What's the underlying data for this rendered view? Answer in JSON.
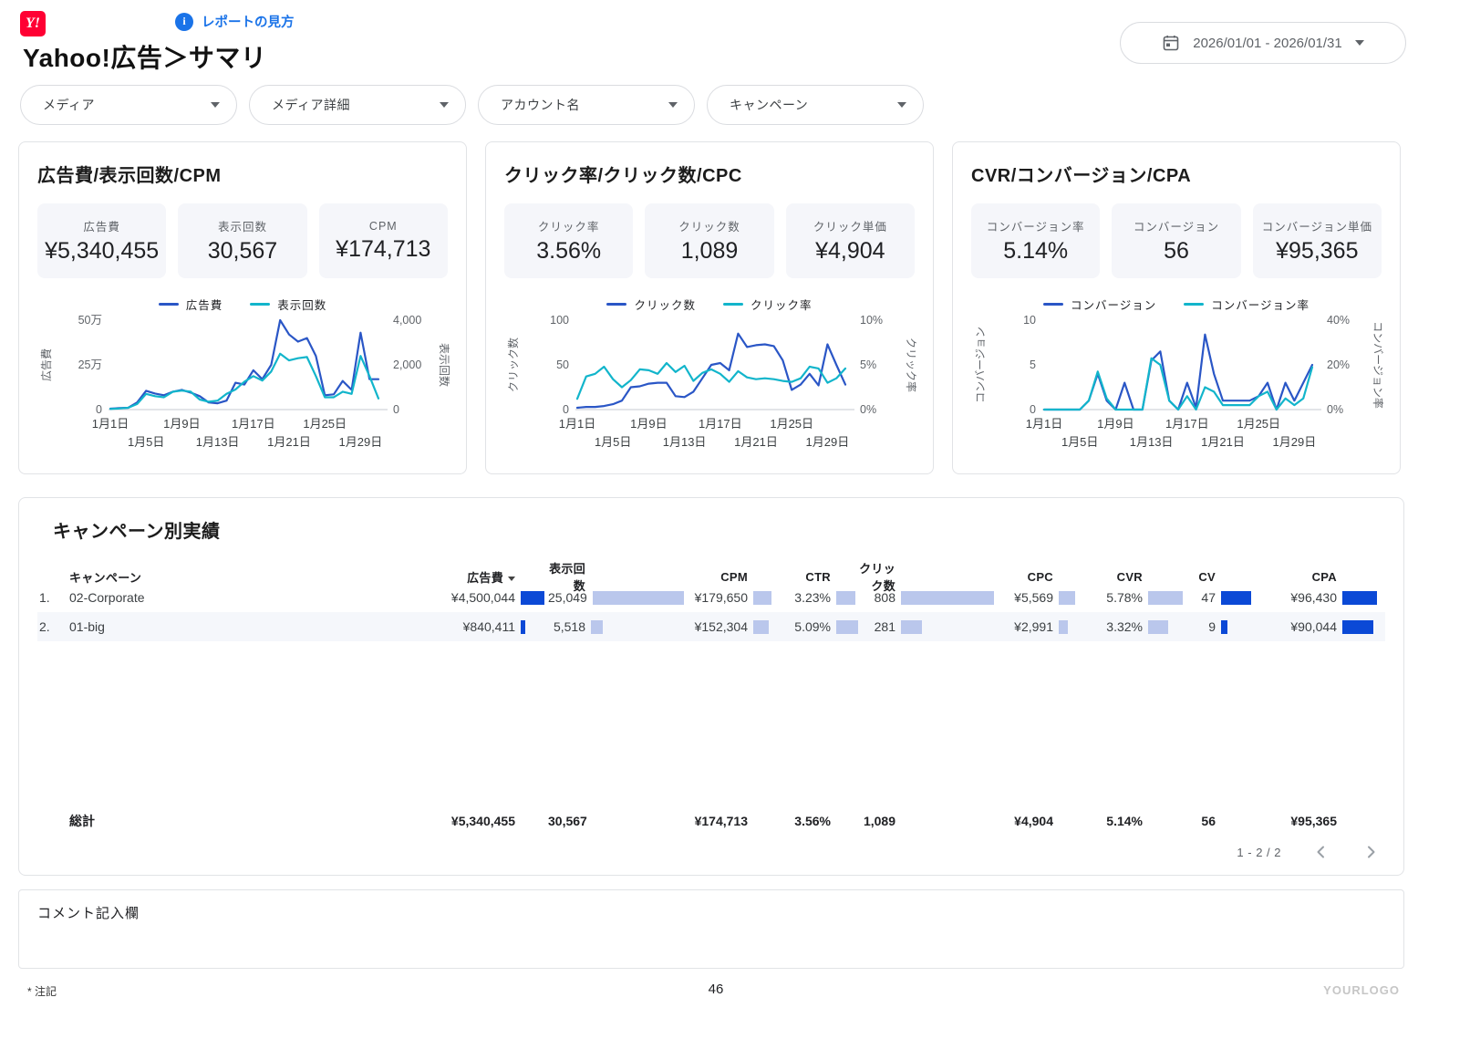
{
  "header": {
    "logo_text": "Y!",
    "help_label": "レポートの見方",
    "title": "Yahoo!広告＞サマリ",
    "date_range": "2026/01/01 - 2026/01/31"
  },
  "filters": [
    {
      "label": "メディア"
    },
    {
      "label": "メディア詳細"
    },
    {
      "label": "アカウント名"
    },
    {
      "label": "キャンペーン"
    }
  ],
  "colors": {
    "series_blue": "#2a56c6",
    "series_teal": "#12b5cb",
    "bar_dark": "#0b49d6",
    "bar_light": "#bac7ec",
    "link_blue": "#1a73e8",
    "logo_red": "#ff0033"
  },
  "cards": [
    {
      "title": "広告費/表示回数/CPM",
      "scorecards": [
        {
          "label": "広告費",
          "value": "¥5,340,455"
        },
        {
          "label": "表示回数",
          "value": "30,567"
        },
        {
          "label": "CPM",
          "value": "¥174,713"
        }
      ]
    },
    {
      "title": "クリック率/クリック数/CPC",
      "scorecards": [
        {
          "label": "クリック率",
          "value": "3.56%"
        },
        {
          "label": "クリック数",
          "value": "1,089"
        },
        {
          "label": "クリック単価",
          "value": "¥4,904"
        }
      ]
    },
    {
      "title": "CVR/コンバージョン/CPA",
      "scorecards": [
        {
          "label": "コンバージョン率",
          "value": "5.14%"
        },
        {
          "label": "コンバージョン",
          "value": "56"
        },
        {
          "label": "コンバージョン単価",
          "value": "¥95,365"
        }
      ]
    }
  ],
  "chart_data": [
    {
      "type": "line",
      "x_tick_days": [
        1,
        5,
        9,
        13,
        17,
        21,
        25,
        29
      ],
      "x_tick_labels": [
        "1月1日",
        "1月5日",
        "1月9日",
        "1月13日",
        "1月17日",
        "1月21日",
        "1月25日",
        "1月29日"
      ],
      "left_axis": {
        "label": "広告費",
        "ticks": [
          "0",
          "25万",
          "50万"
        ],
        "max": 50,
        "unit": "万円"
      },
      "right_axis": {
        "label": "表示回数",
        "ticks": [
          "0",
          "2,000",
          "4,000"
        ],
        "max": 4000
      },
      "series": [
        {
          "name": "広告費",
          "axis": "left",
          "color_key": "series_blue",
          "values": [
            0.5,
            0.8,
            1,
            4,
            10.5,
            9,
            8,
            10,
            11,
            9.5,
            7.5,
            4,
            3.5,
            5,
            15,
            14,
            22,
            17,
            25,
            50,
            42,
            38,
            40,
            30,
            8,
            8.5,
            16,
            11,
            43,
            17,
            17
          ]
        },
        {
          "name": "表示回数",
          "axis": "right",
          "color_key": "series_teal",
          "values": [
            30,
            50,
            80,
            250,
            700,
            600,
            550,
            800,
            850,
            800,
            450,
            350,
            400,
            700,
            900,
            1250,
            1500,
            1300,
            1700,
            2500,
            2200,
            2300,
            2350,
            1500,
            550,
            550,
            800,
            700,
            2400,
            1500,
            500
          ]
        }
      ]
    },
    {
      "type": "line",
      "x_tick_days": [
        1,
        5,
        9,
        13,
        17,
        21,
        25,
        29
      ],
      "x_tick_labels": [
        "1月1日",
        "1月5日",
        "1月9日",
        "1月13日",
        "1月17日",
        "1月21日",
        "1月25日",
        "1月29日"
      ],
      "left_axis": {
        "label": "クリック数",
        "ticks": [
          "0",
          "50",
          "100"
        ],
        "max": 100
      },
      "right_axis": {
        "label": "クリック率",
        "ticks": [
          "0%",
          "5%",
          "10%"
        ],
        "max": 10,
        "unit": "%"
      },
      "series": [
        {
          "name": "クリック数",
          "axis": "left",
          "color_key": "series_blue",
          "values": [
            2,
            3,
            3,
            4,
            6,
            10,
            25,
            26,
            29,
            30,
            30,
            15,
            14,
            20,
            35,
            50,
            52,
            44,
            85,
            70,
            72,
            73,
            71,
            55,
            22,
            28,
            40,
            27,
            73,
            50,
            28
          ]
        },
        {
          "name": "クリック率",
          "axis": "right",
          "color_key": "series_teal",
          "values": [
            1.2,
            3.7,
            4,
            4.8,
            3.4,
            2.5,
            3.3,
            4.5,
            4.4,
            4,
            5.2,
            4.2,
            4.9,
            3.2,
            4.1,
            4.5,
            4,
            3.1,
            4.3,
            3.6,
            3.4,
            3.5,
            3.4,
            3.2,
            3.1,
            3.5,
            4.8,
            4.6,
            3,
            3.5,
            4.6
          ]
        }
      ]
    },
    {
      "type": "line",
      "x_tick_days": [
        1,
        5,
        9,
        13,
        17,
        21,
        25,
        29
      ],
      "x_tick_labels": [
        "1月1日",
        "1月5日",
        "1月9日",
        "1月13日",
        "1月17日",
        "1月21日",
        "1月25日",
        "1月29日"
      ],
      "left_axis": {
        "label": "コンバージョン",
        "ticks": [
          "0",
          "5",
          "10"
        ],
        "max": 10
      },
      "right_axis": {
        "label": "コンバージョン率",
        "ticks": [
          "0%",
          "20%",
          "40%"
        ],
        "max": 40,
        "unit": "%"
      },
      "series": [
        {
          "name": "コンバージョン",
          "axis": "left",
          "color_key": "series_blue",
          "values": [
            0,
            0,
            0,
            0,
            0,
            1,
            4,
            1,
            0,
            3,
            0,
            0,
            5.5,
            6.5,
            1,
            0,
            3,
            0.2,
            8.4,
            4,
            1,
            1,
            1,
            1,
            1.5,
            3,
            0,
            3,
            1,
            3,
            5
          ]
        },
        {
          "name": "コンバージョン率",
          "axis": "right",
          "color_key": "series_teal",
          "values": [
            0,
            0,
            0,
            0,
            0,
            4,
            17,
            5,
            0,
            0,
            0,
            0,
            23,
            20,
            4,
            0,
            6,
            0,
            10,
            8,
            2,
            2,
            2,
            2,
            6,
            8,
            0,
            5,
            2,
            5,
            19
          ]
        }
      ]
    }
  ],
  "table": {
    "title": "キャンペーン別実績",
    "first_column": "キャンペーン",
    "columns": [
      "広告費",
      "表示回数",
      "CPM",
      "CTR",
      "クリック数",
      "CPC",
      "CVR",
      "CV",
      "CPA"
    ],
    "sorted_column": "広告費",
    "bar_tracks": [
      30,
      105,
      25,
      24,
      105,
      25,
      40,
      36,
      39
    ],
    "rows": [
      {
        "index": "1.",
        "campaign": "02-Corporate",
        "metrics": [
          {
            "v": "¥4,500,044",
            "bar": 26,
            "dark": true
          },
          {
            "v": "25,049",
            "bar": 100,
            "dark": false
          },
          {
            "v": "¥179,650",
            "bar": 20,
            "dark": false
          },
          {
            "v": "3.23%",
            "bar": 21,
            "dark": false
          },
          {
            "v": "808",
            "bar": 102,
            "dark": false
          },
          {
            "v": "¥5,569",
            "bar": 18,
            "dark": false
          },
          {
            "v": "5.78%",
            "bar": 38,
            "dark": false
          },
          {
            "v": "47",
            "bar": 33,
            "dark": true
          },
          {
            "v": "¥96,430",
            "bar": 38,
            "dark": true
          }
        ]
      },
      {
        "index": "2.",
        "campaign": "01-big",
        "metrics": [
          {
            "v": "¥840,411",
            "bar": 5,
            "dark": true
          },
          {
            "v": "5,518",
            "bar": 13,
            "dark": false
          },
          {
            "v": "¥152,304",
            "bar": 17,
            "dark": false
          },
          {
            "v": "5.09%",
            "bar": 33,
            "dark": false
          },
          {
            "v": "281",
            "bar": 23,
            "dark": false
          },
          {
            "v": "¥2,991",
            "bar": 10,
            "dark": false
          },
          {
            "v": "3.32%",
            "bar": 22,
            "dark": false
          },
          {
            "v": "9",
            "bar": 7,
            "dark": true
          },
          {
            "v": "¥90,044",
            "bar": 34,
            "dark": true
          }
        ]
      }
    ],
    "totals": {
      "label": "総計",
      "values": [
        "¥5,340,455",
        "30,567",
        "¥174,713",
        "3.56%",
        "1,089",
        "¥4,904",
        "5.14%",
        "56",
        "¥95,365"
      ]
    },
    "pagination": {
      "label": "1 - 2 / 2"
    }
  },
  "comment": {
    "label": "コメント記入欄"
  },
  "footer": {
    "note": "* 注記",
    "page_number": "46",
    "watermark": "YOURLOGO"
  }
}
